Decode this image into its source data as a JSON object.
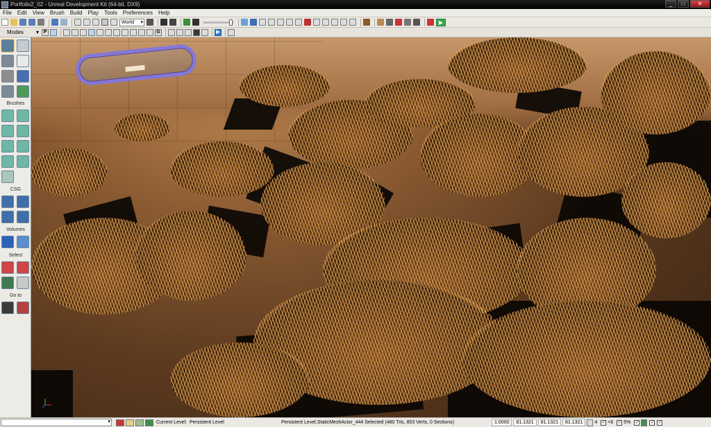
{
  "window": {
    "title": "Portfolio2_02 - Unreal Development Kit (64-bit, DX9)",
    "controls": [
      "_",
      "□",
      "✕"
    ]
  },
  "menu": [
    "File",
    "Edit",
    "View",
    "Brush",
    "Build",
    "Play",
    "Tools",
    "Preferences",
    "Help"
  ],
  "toolbar": {
    "coordinate_system": "World",
    "play_icon": "▶"
  },
  "modes_bar": {
    "label": "Modes",
    "perspective_label": "P",
    "game_label": "G"
  },
  "modes_panel": {
    "sections": {
      "brushes": "Brushes",
      "csg": "CSG",
      "volumes": "Volumes",
      "select": "Select",
      "goto": "Go to"
    }
  },
  "status_bar": {
    "current_level_label": "Current Level:",
    "current_level_value": "Persistent Level",
    "selection_info": "Persistent Level.StaticMeshActor_444 Selected (480 Tris, 853 Verts, 0 Sections)",
    "drag_grid": "1.0000",
    "coords": [
      "81.1321",
      "81.1321",
      "81.1321"
    ],
    "grid_size": "4",
    "rotation_snap": "<6",
    "scale_snap": "5%"
  },
  "colors": {
    "titlebar": "#000000",
    "chrome": "#eae8e1",
    "portal_rim": "#8577d8",
    "play_green": "#3fa83f",
    "ground": "#8a5a32",
    "grass": "#e8aa5a"
  }
}
